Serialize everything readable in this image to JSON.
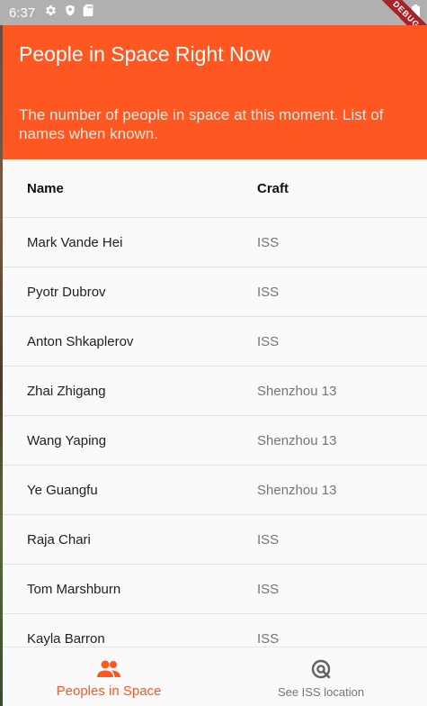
{
  "status_bar": {
    "time": "6:37",
    "debug_label": "DEBUG",
    "icons": [
      "gear-icon",
      "shield-icon",
      "sd-card-icon",
      "wifi-icon",
      "battery-icon"
    ]
  },
  "app_bar": {
    "title": "People in Space Right Now",
    "subtitle": "The number of people in space at this moment. List of names when known.",
    "color": "#ff5722"
  },
  "table": {
    "columns": {
      "name": "Name",
      "craft": "Craft"
    },
    "rows": [
      {
        "name": "Mark Vande Hei",
        "craft": "ISS"
      },
      {
        "name": "Pyotr Dubrov",
        "craft": "ISS"
      },
      {
        "name": "Anton Shkaplerov",
        "craft": "ISS"
      },
      {
        "name": "Zhai Zhigang",
        "craft": "Shenzhou 13"
      },
      {
        "name": "Wang Yaping",
        "craft": "Shenzhou 13"
      },
      {
        "name": "Ye Guangfu",
        "craft": "Shenzhou 13"
      },
      {
        "name": "Raja Chari",
        "craft": "ISS"
      },
      {
        "name": "Tom Marshburn",
        "craft": "ISS"
      },
      {
        "name": "Kayla Barron",
        "craft": "ISS"
      }
    ]
  },
  "bottom_nav": {
    "items": [
      {
        "label": "Peoples in Space",
        "icon": "people-icon",
        "selected": true
      },
      {
        "label": "See ISS location",
        "icon": "location-search-icon",
        "selected": false
      }
    ],
    "active_color": "#ff5722",
    "inactive_color": "#757575"
  }
}
